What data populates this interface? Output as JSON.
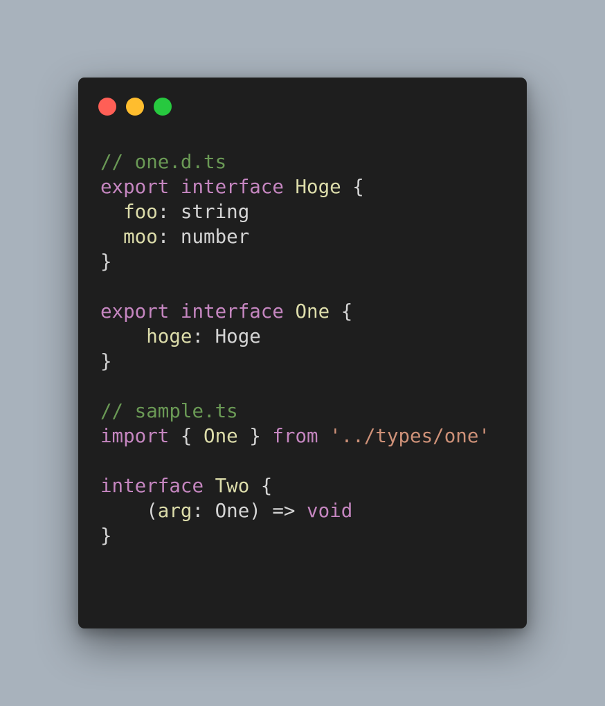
{
  "colors": {
    "background": "#a8b2bc",
    "window": "#1e1e1e",
    "comment": "#6a9955",
    "keyword": "#c586c0",
    "type": "#dcdcaa",
    "property": "#dcdcaa",
    "string": "#ce9178",
    "plain": "#d4d4d4"
  },
  "window_controls": [
    {
      "name": "close-dot",
      "color": "#ff5f56"
    },
    {
      "name": "minimize-dot",
      "color": "#ffbd2e"
    },
    {
      "name": "maximize-dot",
      "color": "#27c93f"
    }
  ],
  "code_lines": [
    [
      {
        "t": "// one.d.ts",
        "k": "comment"
      }
    ],
    [
      {
        "t": "export",
        "k": "keyword"
      },
      {
        "t": " ",
        "k": "plain"
      },
      {
        "t": "interface",
        "k": "keyword"
      },
      {
        "t": " ",
        "k": "plain"
      },
      {
        "t": "Hoge",
        "k": "type"
      },
      {
        "t": " {",
        "k": "plain"
      }
    ],
    [
      {
        "t": "  ",
        "k": "plain"
      },
      {
        "t": "foo",
        "k": "property"
      },
      {
        "t": ": string",
        "k": "plain"
      }
    ],
    [
      {
        "t": "  ",
        "k": "plain"
      },
      {
        "t": "moo",
        "k": "property"
      },
      {
        "t": ": number",
        "k": "plain"
      }
    ],
    [
      {
        "t": "}",
        "k": "plain"
      }
    ],
    [],
    [
      {
        "t": "export",
        "k": "keyword"
      },
      {
        "t": " ",
        "k": "plain"
      },
      {
        "t": "interface",
        "k": "keyword"
      },
      {
        "t": " ",
        "k": "plain"
      },
      {
        "t": "One",
        "k": "type"
      },
      {
        "t": " {",
        "k": "plain"
      }
    ],
    [
      {
        "t": "    ",
        "k": "plain"
      },
      {
        "t": "hoge",
        "k": "property"
      },
      {
        "t": ": Hoge",
        "k": "plain"
      }
    ],
    [
      {
        "t": "}",
        "k": "plain"
      }
    ],
    [],
    [
      {
        "t": "// sample.ts",
        "k": "comment"
      }
    ],
    [
      {
        "t": "import",
        "k": "keyword"
      },
      {
        "t": " { ",
        "k": "plain"
      },
      {
        "t": "One",
        "k": "type"
      },
      {
        "t": " } ",
        "k": "plain"
      },
      {
        "t": "from",
        "k": "keyword"
      },
      {
        "t": " ",
        "k": "plain"
      },
      {
        "t": "'../types/one'",
        "k": "string"
      }
    ],
    [],
    [
      {
        "t": "interface",
        "k": "keyword"
      },
      {
        "t": " ",
        "k": "plain"
      },
      {
        "t": "Two",
        "k": "type"
      },
      {
        "t": " {",
        "k": "plain"
      }
    ],
    [
      {
        "t": "    (",
        "k": "plain"
      },
      {
        "t": "arg",
        "k": "property"
      },
      {
        "t": ": One) => ",
        "k": "plain"
      },
      {
        "t": "void",
        "k": "keyword"
      }
    ],
    [
      {
        "t": "}",
        "k": "plain"
      }
    ]
  ]
}
